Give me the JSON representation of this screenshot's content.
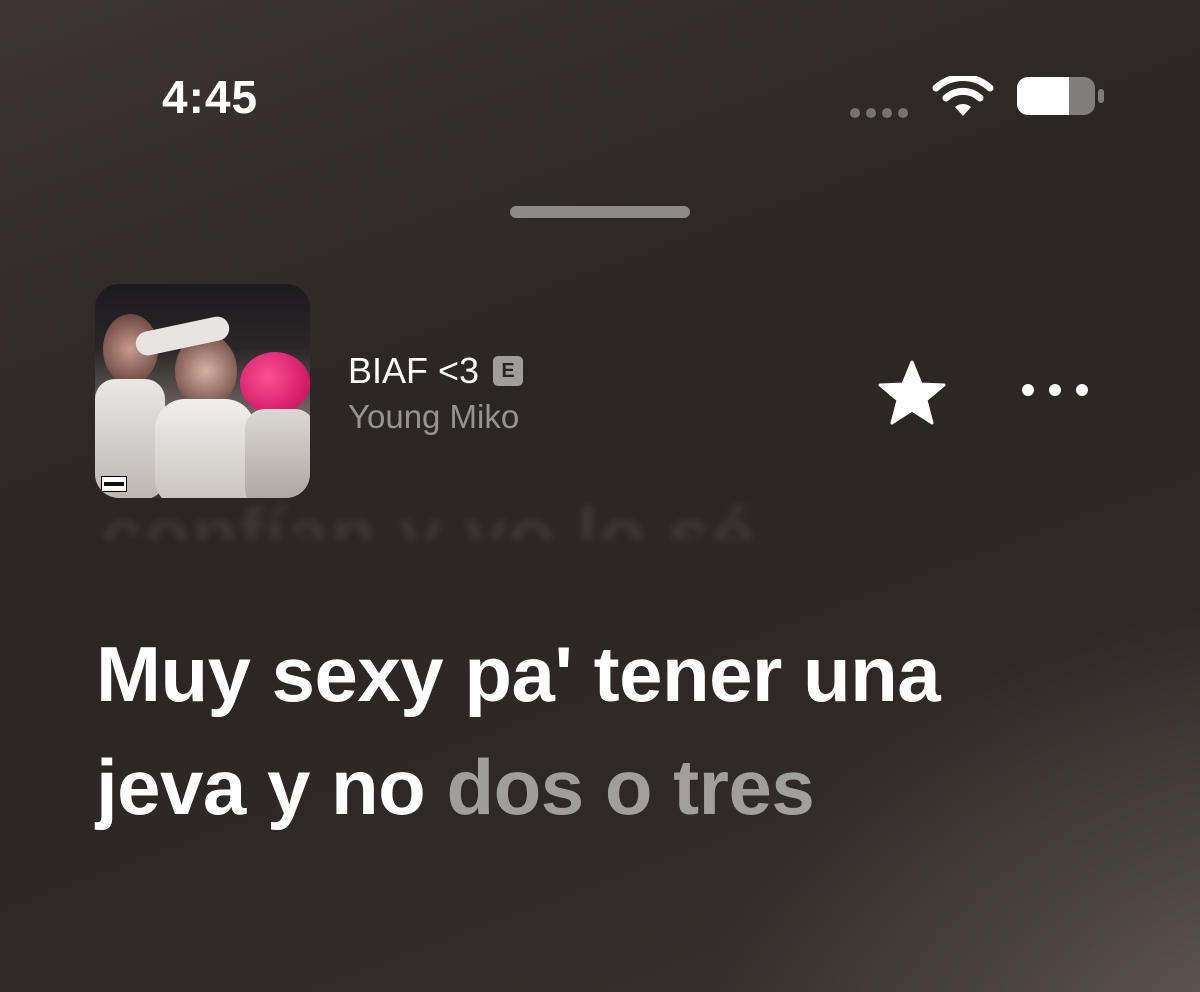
{
  "status_bar": {
    "time": "4:45",
    "wifi_icon": "wifi-icon",
    "battery_icon": "battery-icon",
    "battery_level": 0.65
  },
  "now_playing": {
    "title": "BIAF <3",
    "explicit_label": "E",
    "artist": "Young Miko",
    "star_icon": "star-icon",
    "more_icon": "ellipsis-icon"
  },
  "lyrics": {
    "previous_line": "confían y yo lo sé",
    "current_line_sung": "Muy sexy pa' tener una jeva y no ",
    "current_line_upcoming": "dos o tres"
  },
  "colors": {
    "background": "#2e2826",
    "text_primary": "#ffffff",
    "text_secondary": "#8f8886"
  }
}
